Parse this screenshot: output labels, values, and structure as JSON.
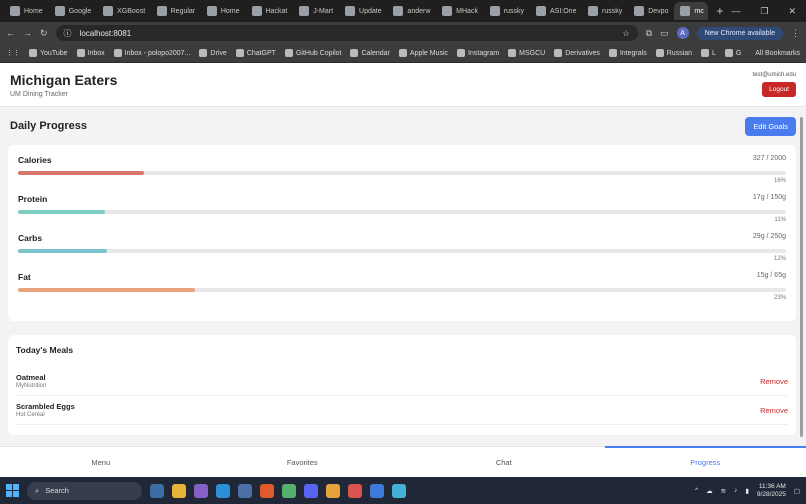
{
  "browser": {
    "tabs": [
      "Home",
      "Google",
      "XGBoost",
      "Regular",
      "Home",
      "Hackat",
      "J-Mart",
      "Update",
      "anderw",
      "MHack",
      "russky",
      "ASI:One",
      "russky",
      "Devpo",
      "mc"
    ],
    "url": "localhost:8081",
    "update_chip": "New Chrome available",
    "avatar_letter": "A",
    "bookmarks": [
      "YouTube",
      "Inbox",
      "Inbox - polopo2007...",
      "Drive",
      "ChatGPT",
      "GitHub Copilot",
      "Calendar",
      "Apple Music",
      "Instagram",
      "MSGCU",
      "Derivatives",
      "Integrals",
      "Russian",
      "L",
      "G"
    ],
    "all_bookmarks": "All Bookmarks"
  },
  "header": {
    "title": "Michigan Eaters",
    "subtitle": "UM Dining Tracker",
    "user_email": "test@umich.edu",
    "logout_label": "Logout"
  },
  "progress": {
    "title": "Daily Progress",
    "edit_label": "Edit Goals",
    "nutrients": [
      {
        "name": "Calories",
        "amount": "327 / 2000",
        "pct_label": "16%",
        "fraction": 0.164,
        "color": "#d9776a"
      },
      {
        "name": "Protein",
        "amount": "17g / 150g",
        "pct_label": "11%",
        "fraction": 0.113,
        "color": "#7ecdc2"
      },
      {
        "name": "Carbs",
        "amount": "29g / 250g",
        "pct_label": "12%",
        "fraction": 0.116,
        "color": "#7cc3cc"
      },
      {
        "name": "Fat",
        "amount": "15g / 65g",
        "pct_label": "23%",
        "fraction": 0.231,
        "color": "#eaa37a"
      }
    ]
  },
  "meals": {
    "title": "Today's Meals",
    "remove_label": "Remove",
    "items": [
      {
        "name": "Oatmeal",
        "source": "MyNutrition"
      },
      {
        "name": "Scrambled Eggs",
        "source": "Hot Cereal"
      }
    ]
  },
  "nav": {
    "items": [
      "Menu",
      "Favorites",
      "Chat",
      "Progress"
    ],
    "active": "Progress"
  },
  "taskbar": {
    "search_placeholder": "Search",
    "time": "11:36 AM",
    "date": "9/28/2025"
  }
}
